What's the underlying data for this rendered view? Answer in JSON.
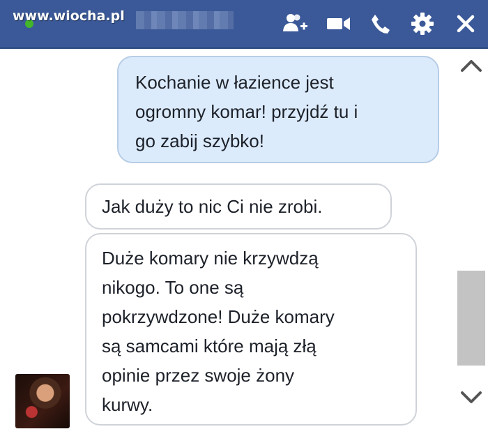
{
  "header": {
    "watermark": "www.wiocha.pl",
    "icons": [
      "add-people-icon",
      "video-call-icon",
      "phone-call-icon",
      "gear-icon",
      "close-icon"
    ],
    "bg_color": "#3b5998"
  },
  "messages": {
    "sent": {
      "lines": [
        "Kochanie w łazience jest",
        "ogromny komar! przyjdź tu i",
        "go zabij szybko!"
      ],
      "bubble_color": "#dcebfc"
    },
    "received_1": {
      "lines": [
        "Jak duży to nic Ci nie zrobi."
      ]
    },
    "received_2": {
      "lines": [
        "Duże komary nie krzywdzą",
        "nikogo. To one są",
        "pokrzywdzone! Duże komary",
        "są samcami które mają złą",
        "opinie przez swoje żony",
        "kurwy."
      ]
    }
  },
  "scroll": {
    "up_icon": "chevron-up-icon",
    "down_icon": "chevron-down-icon"
  }
}
